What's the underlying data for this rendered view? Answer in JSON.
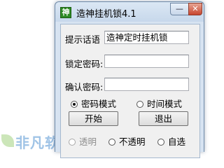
{
  "watermark": {
    "text": "非凡软件站"
  },
  "window": {
    "title": "造神挂机锁4.1",
    "app_icon_glyph": "神",
    "minimize_glyph": "—",
    "close_glyph": "✕"
  },
  "form": {
    "prompt_label": "提示话语",
    "prompt_value": "造神定时挂机锁",
    "lock_password_label": "锁定密码:",
    "lock_password_value": "",
    "confirm_password_label": "确认密码:",
    "confirm_password_value": ""
  },
  "mode": {
    "password_mode_label": "密码模式",
    "time_mode_label": "时间模式",
    "selected": "password"
  },
  "buttons": {
    "start_label": "开始",
    "exit_label": "退出"
  },
  "appearance": {
    "transparent_label": "透明",
    "opaque_label": "不透明",
    "custom_label": "自选"
  }
}
